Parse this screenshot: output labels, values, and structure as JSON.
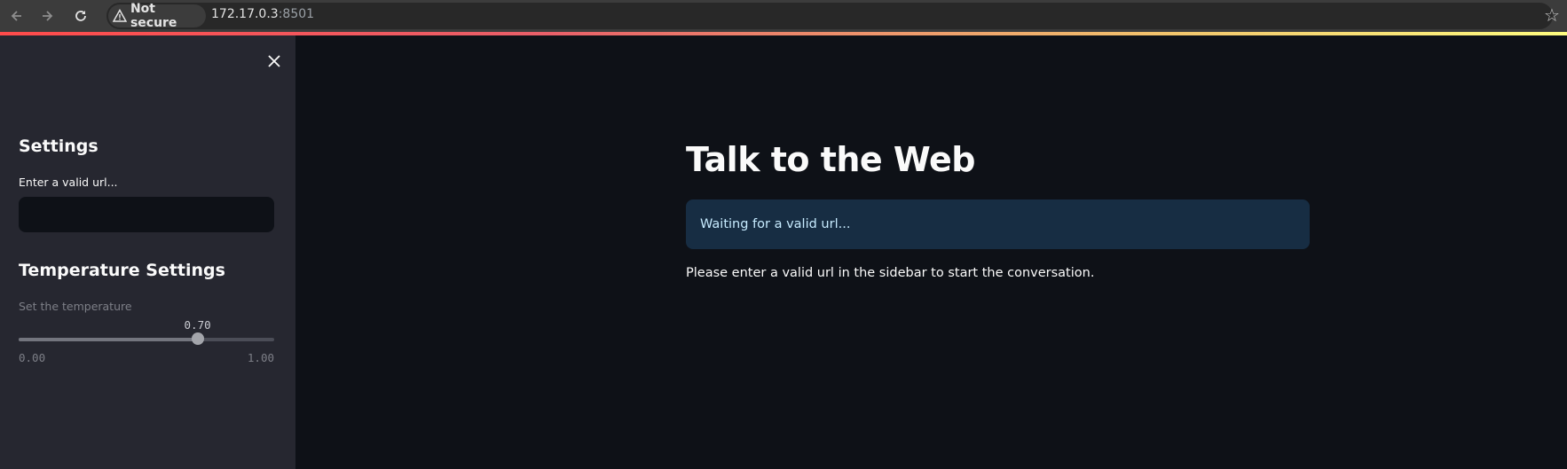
{
  "browser": {
    "security_label": "Not secure",
    "url_host": "172.17.0.3",
    "url_port": ":8501",
    "icons": [
      "back-arrow-icon",
      "forward-arrow-icon",
      "reload-icon",
      "warning-triangle-icon",
      "bookmark-star-icon"
    ]
  },
  "sidebar": {
    "settings_heading": "Settings",
    "url_label": "Enter a valid url...",
    "url_value": "",
    "temperature_heading": "Temperature Settings",
    "temperature_label": "Set the temperature",
    "temperature_value": "0.70",
    "temperature_fraction": 0.7,
    "temperature_min": "0.00",
    "temperature_max": "1.00"
  },
  "main": {
    "title": "Talk to the Web",
    "info_message": "Waiting for a valid url...",
    "instruction": "Please enter a valid url in the sidebar to start the conversation."
  },
  "colors": {
    "background": "#0e1117",
    "sidebar": "#262730",
    "info_box": "#172d43",
    "info_text": "#c7ebff",
    "accent_gradient_start": "#ff4b4b",
    "accent_gradient_end": "#fffd80"
  }
}
